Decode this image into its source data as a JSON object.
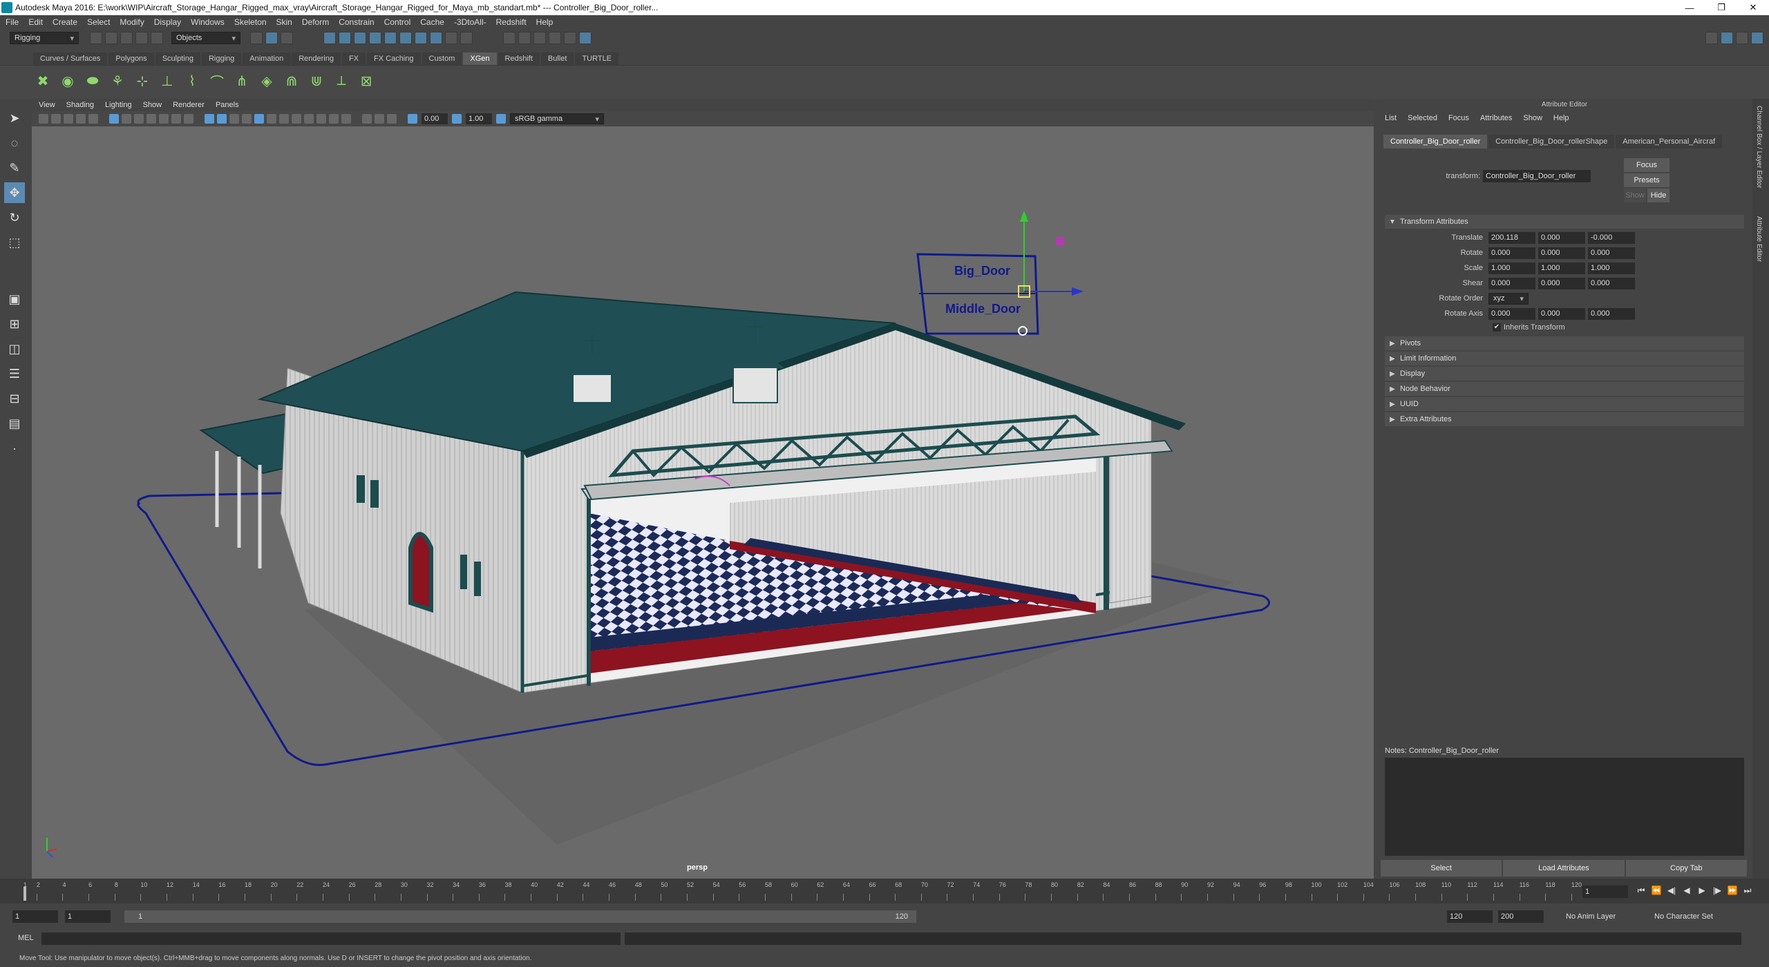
{
  "titlebar": {
    "title": "Autodesk Maya 2016: E:\\work\\WIP\\Aircraft_Storage_Hangar_Rigged_max_vray\\Aircraft_Storage_Hangar_Rigged_for_Maya_mb_standart.mb*  ---  Controller_Big_Door_roller...",
    "minimize": "—",
    "restore": "❐",
    "close": "✕"
  },
  "menubar": [
    "File",
    "Edit",
    "Create",
    "Select",
    "Modify",
    "Display",
    "Windows",
    "Skeleton",
    "Skin",
    "Deform",
    "Constrain",
    "Control",
    "Cache",
    "-3DtoAll-",
    "Redshift",
    "Help"
  ],
  "statusline": {
    "mode": "Rigging",
    "objects_label": "Objects"
  },
  "shelf": {
    "tabs": [
      "Curves / Surfaces",
      "Polygons",
      "Sculpting",
      "Rigging",
      "Animation",
      "Rendering",
      "FX",
      "FX Caching",
      "Custom",
      "XGen",
      "Redshift",
      "Bullet",
      "TURTLE"
    ],
    "active_tab": "XGen"
  },
  "viewport": {
    "menu": [
      "View",
      "Shading",
      "Lighting",
      "Show",
      "Renderer",
      "Panels"
    ],
    "exposure": "0.00",
    "gamma": "1.00",
    "color_space": "sRGB gamma",
    "camera_label": "persp",
    "controller_labels": {
      "big_door": "Big_Door",
      "middle_door": "Middle_Door"
    },
    "colors": {
      "background": "#6a6a6a",
      "roof": "#1f4f55",
      "wall": "#d9d9d9",
      "trim": "#1d4c4f",
      "floor_red": "#8e1320",
      "floor_navy": "#1a2a55",
      "controller_curve": "#101a8a",
      "grid_ground": "#5c5c5c"
    }
  },
  "attribute_editor": {
    "panel_title": "Attribute Editor",
    "menu": [
      "List",
      "Selected",
      "Focus",
      "Attributes",
      "Show",
      "Help"
    ],
    "tabs": [
      "Controller_Big_Door_roller",
      "Controller_Big_Door_rollerShape",
      "American_Personal_Aircraf"
    ],
    "transform_label": "transform:",
    "transform_value": "Controller_Big_Door_roller",
    "buttons": {
      "focus": "Focus",
      "presets": "Presets",
      "show": "Show",
      "hide": "Hide"
    },
    "section_transform": "Transform Attributes",
    "translate": {
      "label": "Translate",
      "x": "200.118",
      "y": "0.000",
      "z": "-0.000"
    },
    "rotate": {
      "label": "Rotate",
      "x": "0.000",
      "y": "0.000",
      "z": "0.000"
    },
    "scale": {
      "label": "Scale",
      "x": "1.000",
      "y": "1.000",
      "z": "1.000"
    },
    "shear": {
      "label": "Shear",
      "x": "0.000",
      "y": "0.000",
      "z": "0.000"
    },
    "rotate_order": {
      "label": "Rotate Order",
      "value": "xyz"
    },
    "rotate_axis": {
      "label": "Rotate Axis",
      "x": "0.000",
      "y": "0.000",
      "z": "0.000"
    },
    "inherits_transform": "Inherits Transform",
    "collapsed_sections": [
      "Pivots",
      "Limit Information",
      "Display",
      "Node Behavior",
      "UUID",
      "Extra Attributes"
    ],
    "notes_label": "Notes: Controller_Big_Door_roller",
    "bottom_buttons": [
      "Select",
      "Load Attributes",
      "Copy Tab"
    ],
    "side_tabs": [
      "Channel Box / Layer Editor",
      "Attribute Editor"
    ]
  },
  "timeline": {
    "ticks": [
      "1",
      "2",
      "4",
      "6",
      "8",
      "10",
      "12",
      "14",
      "16",
      "18",
      "20",
      "22",
      "24",
      "26",
      "28",
      "30",
      "32",
      "34",
      "36",
      "38",
      "40",
      "42",
      "44",
      "46",
      "48",
      "50",
      "52",
      "54",
      "56",
      "58",
      "60",
      "62",
      "64",
      "66",
      "68",
      "70",
      "72",
      "74",
      "76",
      "78",
      "80",
      "82",
      "84",
      "86",
      "88",
      "90",
      "92",
      "94",
      "96",
      "98",
      "100",
      "102",
      "104",
      "106",
      "108",
      "110",
      "112",
      "114",
      "116",
      "118",
      "120"
    ],
    "current_frame": "1"
  },
  "range": {
    "start": "1",
    "playback_start": "1",
    "slider_start": "1",
    "slider_end": "120",
    "playback_end": "120",
    "end": "200",
    "anim_layer": "No Anim Layer",
    "character_set": "No Character Set"
  },
  "command_line": {
    "label": "MEL"
  },
  "help_line": "Move Tool: Use manipulator to move object(s). Ctrl+MMB+drag to move components along normals. Use D or INSERT to change the pivot position and axis orientation."
}
